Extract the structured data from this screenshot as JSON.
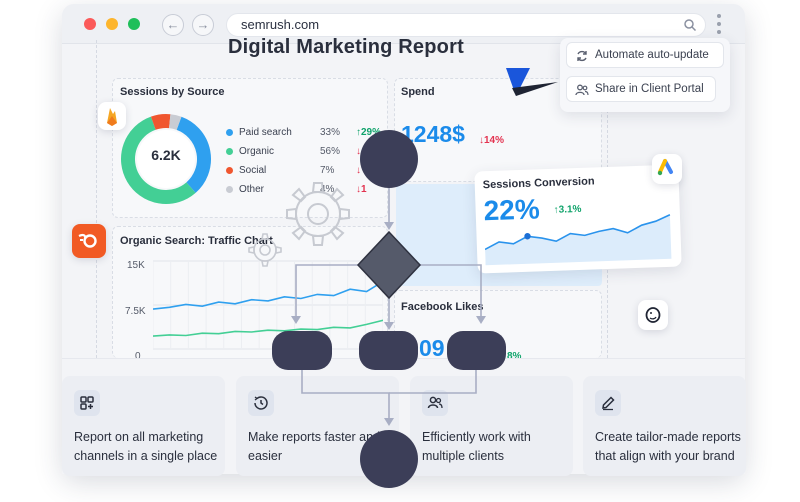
{
  "browser": {
    "url": "semrush.com",
    "back_icon": "arrow-left-icon",
    "forward_icon": "arrow-right-icon"
  },
  "report": {
    "title": "Digital Marketing Report"
  },
  "sessions_by_source": {
    "title": "Sessions by Source",
    "total": "6.2K",
    "items": [
      {
        "label": "Paid search",
        "pct": "33%",
        "change": "29%",
        "dir": "up",
        "color": "#2fa0ef"
      },
      {
        "label": "Organic",
        "pct": "56%",
        "change": "",
        "dir": "down",
        "color": "#43cf95"
      },
      {
        "label": "Social",
        "pct": "7%",
        "change": "",
        "dir": "down",
        "color": "#f0562f"
      },
      {
        "label": "Other",
        "pct": "4%",
        "change": "1",
        "dir": "down",
        "color": "#c9ccd3"
      }
    ],
    "chart_data": {
      "type": "pie",
      "categories": [
        "Paid search",
        "Organic",
        "Social",
        "Other"
      ],
      "values": [
        33,
        56,
        7,
        4
      ]
    }
  },
  "spend": {
    "title": "Spend",
    "value": "1248$",
    "change": "14%",
    "dir": "down"
  },
  "organic_search": {
    "title": "Organic Search: Traffic Chart",
    "y_ticks": [
      "15K",
      "7.5K",
      "0"
    ],
    "chart_data": {
      "type": "line",
      "ylim": [
        0,
        15000
      ],
      "series": [
        {
          "values": [
            6800,
            7100,
            7600,
            7300,
            8000,
            7700,
            8400,
            8200,
            8900,
            8600,
            9300,
            9100,
            10200,
            9800,
            11500
          ]
        },
        {
          "values": [
            2200,
            2400,
            2300,
            2700,
            2600,
            3000,
            2900,
            3200,
            3100,
            3400,
            3300,
            3700,
            3600,
            4200,
            4900
          ]
        }
      ]
    }
  },
  "facebook_likes": {
    "title": "Facebook Likes",
    "value": "09",
    "change": "8%"
  },
  "floating_buttons": {
    "automate": "Automate auto-update",
    "share": "Share in Client Portal"
  },
  "sessions_conversion": {
    "title": "Sessions Conversion",
    "value": "22%",
    "change": "3.1%",
    "dir": "up",
    "chart_data": {
      "type": "area",
      "series": [
        {
          "values": [
            10,
            16,
            14,
            20,
            18,
            15,
            21,
            19,
            22,
            24,
            20,
            26,
            29,
            34
          ]
        }
      ]
    }
  },
  "features": [
    {
      "icon": "grid-plus-icon",
      "text": "Report on all marketing channels in a single place"
    },
    {
      "icon": "clock-refresh-icon",
      "text": "Make reports faster and easier"
    },
    {
      "icon": "users-icon",
      "text": "Efficiently work with multiple clients"
    },
    {
      "icon": "pencil-icon",
      "text": "Create tailor-made reports that align with your brand"
    }
  ],
  "colors": {
    "accent_blue": "#1b8bea",
    "flow_node": "#3c3e58",
    "up": "#10a36b",
    "down": "#e3324f"
  }
}
